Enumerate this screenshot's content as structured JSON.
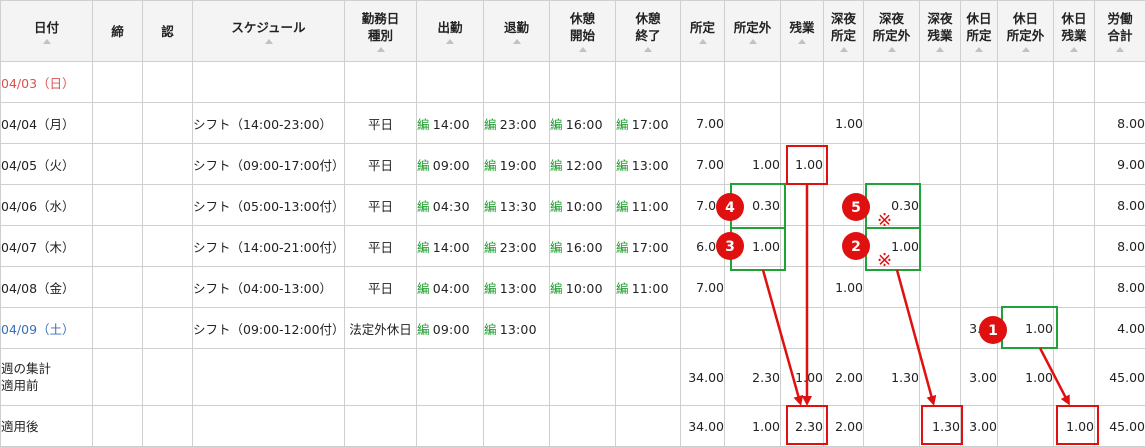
{
  "headers": [
    {
      "lines": [
        "日付"
      ],
      "sort": true
    },
    {
      "lines": [
        "締"
      ],
      "sort": false
    },
    {
      "lines": [
        "認"
      ],
      "sort": false
    },
    {
      "lines": [
        "スケジュール"
      ],
      "sort": true
    },
    {
      "lines": [
        "勤務日",
        "種別"
      ],
      "sort": true
    },
    {
      "lines": [
        "出勤"
      ],
      "sort": true
    },
    {
      "lines": [
        "退勤"
      ],
      "sort": true
    },
    {
      "lines": [
        "休憩",
        "開始"
      ],
      "sort": true
    },
    {
      "lines": [
        "休憩",
        "終了"
      ],
      "sort": true
    },
    {
      "lines": [
        "所定"
      ],
      "sort": true
    },
    {
      "lines": [
        "所定外"
      ],
      "sort": true
    },
    {
      "lines": [
        "残業"
      ],
      "sort": true
    },
    {
      "lines": [
        "深夜",
        "所定"
      ],
      "sort": true
    },
    {
      "lines": [
        "深夜",
        "所定外"
      ],
      "sort": true
    },
    {
      "lines": [
        "深夜",
        "残業"
      ],
      "sort": true
    },
    {
      "lines": [
        "休日",
        "所定"
      ],
      "sort": true
    },
    {
      "lines": [
        "休日",
        "所定外"
      ],
      "sort": true
    },
    {
      "lines": [
        "休日",
        "残業"
      ],
      "sort": true
    },
    {
      "lines": [
        "労働",
        "合計"
      ],
      "sort": true
    }
  ],
  "edit_mark": "編",
  "rows": [
    {
      "date": "04/03（日）",
      "day": "sun",
      "schedule": "",
      "daytype": "",
      "in": "",
      "out": "",
      "bstart": "",
      "bend": "",
      "shotei": "",
      "shoteigai": "",
      "zangyo": "",
      "sh_shotei": "",
      "sh_shoteigai": "",
      "sh_zangyo": "",
      "kj_shotei": "",
      "kj_shoteigai": "",
      "kj_zangyo": "",
      "total": ""
    },
    {
      "date": "04/04（月）",
      "day": "wk",
      "schedule": "シフト（14:00-23:00）",
      "daytype": "平日",
      "in": "14:00",
      "out": "23:00",
      "bstart": "16:00",
      "bend": "17:00",
      "shotei": "7.00",
      "shoteigai": "",
      "zangyo": "",
      "sh_shotei": "1.00",
      "sh_shoteigai": "",
      "sh_zangyo": "",
      "kj_shotei": "",
      "kj_shoteigai": "",
      "kj_zangyo": "",
      "total": "8.00"
    },
    {
      "date": "04/05（火）",
      "day": "wk",
      "schedule": "シフト（09:00-17:00付）",
      "daytype": "平日",
      "in": "09:00",
      "out": "19:00",
      "bstart": "12:00",
      "bend": "13:00",
      "shotei": "7.00",
      "shoteigai": "1.00",
      "zangyo": "1.00",
      "sh_shotei": "",
      "sh_shoteigai": "",
      "sh_zangyo": "",
      "kj_shotei": "",
      "kj_shoteigai": "",
      "kj_zangyo": "",
      "total": "9.00"
    },
    {
      "date": "04/06（水）",
      "day": "wk",
      "schedule": "シフト（05:00-13:00付）",
      "daytype": "平日",
      "in": "04:30",
      "out": "13:30",
      "bstart": "10:00",
      "bend": "11:00",
      "shotei": "7.00",
      "shoteigai": "0.30",
      "zangyo": "",
      "sh_shotei": "",
      "sh_shoteigai": "0.30",
      "sh_zangyo": "",
      "kj_shotei": "",
      "kj_shoteigai": "",
      "kj_zangyo": "",
      "total": "8.00"
    },
    {
      "date": "04/07（木）",
      "day": "wk",
      "schedule": "シフト（14:00-21:00付）",
      "daytype": "平日",
      "in": "14:00",
      "out": "23:00",
      "bstart": "16:00",
      "bend": "17:00",
      "shotei": "6.00",
      "shoteigai": "1.00",
      "zangyo": "",
      "sh_shotei": "",
      "sh_shoteigai": "1.00",
      "sh_zangyo": "",
      "kj_shotei": "",
      "kj_shoteigai": "",
      "kj_zangyo": "",
      "total": "8.00"
    },
    {
      "date": "04/08（金）",
      "day": "wk",
      "schedule": "シフト（04:00-13:00）",
      "daytype": "平日",
      "in": "04:00",
      "out": "13:00",
      "bstart": "10:00",
      "bend": "11:00",
      "shotei": "7.00",
      "shoteigai": "",
      "zangyo": "",
      "sh_shotei": "1.00",
      "sh_shoteigai": "",
      "sh_zangyo": "",
      "kj_shotei": "",
      "kj_shoteigai": "",
      "kj_zangyo": "",
      "total": "8.00"
    },
    {
      "date": "04/09（土）",
      "day": "sat",
      "schedule": "シフト（09:00-12:00付）",
      "daytype": "法定外休日",
      "in": "09:00",
      "out": "13:00",
      "bstart": "",
      "bend": "",
      "shotei": "",
      "shoteigai": "",
      "zangyo": "",
      "sh_shotei": "",
      "sh_shoteigai": "",
      "sh_zangyo": "",
      "kj_shotei": "3.00",
      "kj_shoteigai": "1.00",
      "kj_zangyo": "",
      "total": "4.00"
    }
  ],
  "summary": [
    {
      "label_lines": [
        "週の集計",
        "適用前"
      ],
      "shotei": "34.00",
      "shoteigai": "2.30",
      "zangyo": "1.00",
      "sh_shotei": "2.00",
      "sh_shoteigai": "1.30",
      "sh_zangyo": "",
      "kj_shotei": "3.00",
      "kj_shoteigai": "1.00",
      "kj_zangyo": "",
      "total": "45.00"
    },
    {
      "label_lines": [
        "適用後"
      ],
      "shotei": "34.00",
      "shoteigai": "1.00",
      "zangyo": "2.30",
      "sh_shotei": "2.00",
      "sh_shoteigai": "",
      "sh_zangyo": "1.30",
      "kj_shotei": "3.00",
      "kj_shoteigai": "",
      "kj_zangyo": "1.00",
      "total": "45.00"
    }
  ],
  "annotations": {
    "badges": [
      "1",
      "2",
      "3",
      "4",
      "5"
    ],
    "mark": "※",
    "green": "#22a03a",
    "red": "#e01010"
  }
}
